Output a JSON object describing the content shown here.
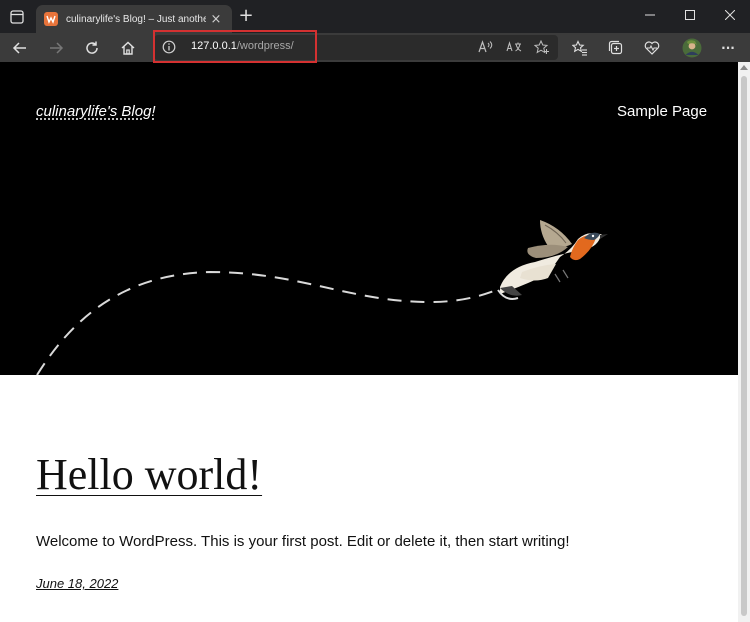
{
  "browser": {
    "tab": {
      "title": "culinarylife's Blog! – Just another",
      "favicon": "wordpress-local-icon",
      "close_label": "×"
    },
    "new_tab_label": "+",
    "address": {
      "host": "127.0.0.1",
      "path": "/wordpress/"
    },
    "address_icons": [
      "read-aloud-icon",
      "translate-icon",
      "add-favorite-icon"
    ],
    "toolbar_icons": [
      "favorites-icon",
      "collections-icon",
      "health-icon",
      "profile-avatar",
      "more-icon"
    ],
    "more_label": "···",
    "accent": "#d43131"
  },
  "site": {
    "title": "culinarylife's Blog!",
    "nav": [
      "Sample Page"
    ],
    "hero_bg": "#000000"
  },
  "post": {
    "title": "Hello world!",
    "body": "Welcome to WordPress. This is your first post. Edit or delete it, then start writing!",
    "date": "June 18, 2022"
  }
}
